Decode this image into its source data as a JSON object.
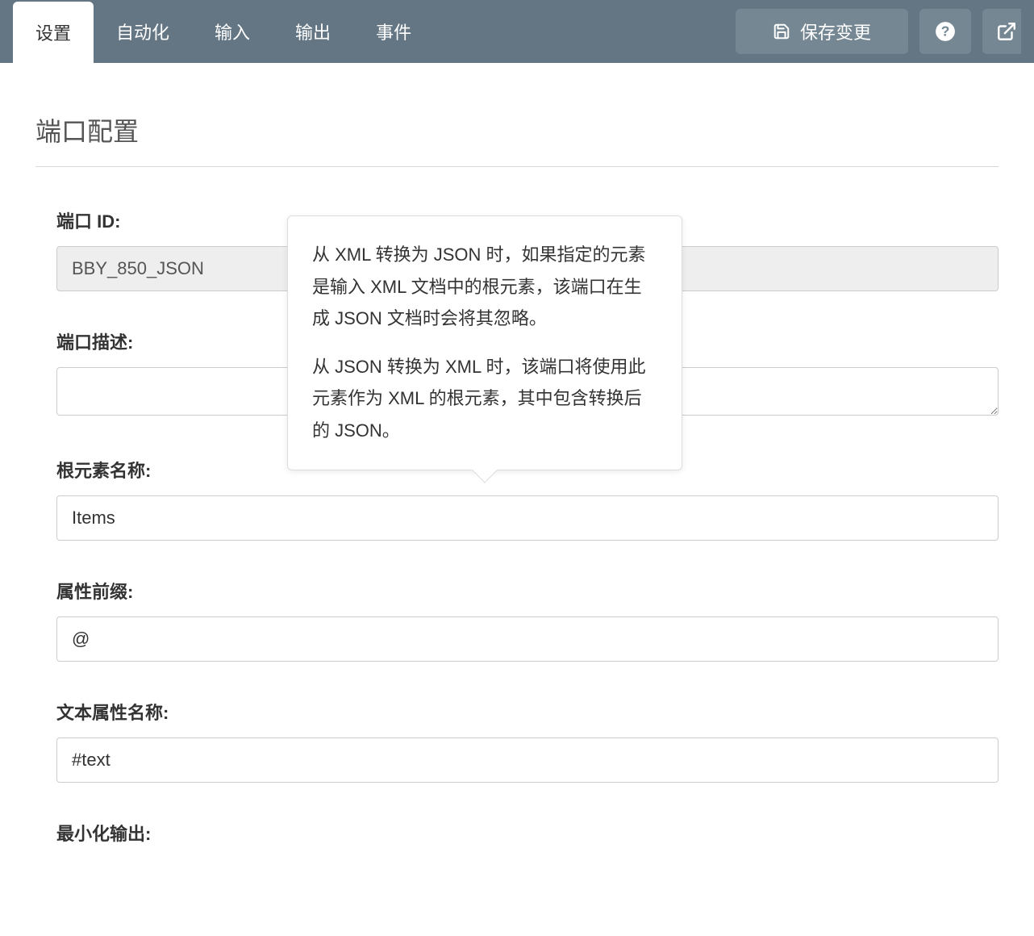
{
  "tabs": {
    "settings": "设置",
    "automation": "自动化",
    "input": "输入",
    "output": "输出",
    "events": "事件"
  },
  "header": {
    "save_label": "保存变更"
  },
  "page": {
    "title": "端口配置"
  },
  "fields": {
    "port_id": {
      "label": "端口 ID:",
      "value": "BBY_850_JSON"
    },
    "port_desc": {
      "label": "端口描述:",
      "value": ""
    },
    "root_element": {
      "label": "根元素名称:",
      "value": "Items"
    },
    "attr_prefix": {
      "label": "属性前缀:",
      "value": "@"
    },
    "text_attr_name": {
      "label": "文本属性名称:",
      "value": "#text"
    },
    "minimize_output": {
      "label": "最小化输出:"
    }
  },
  "tooltip": {
    "p1": "从 XML 转换为 JSON 时，如果指定的元素是输入 XML 文档中的根元素，该端口在生成 JSON 文档时会将其忽略。",
    "p2": "从 JSON 转换为 XML 时，该端口将使用此元素作为 XML 的根元素，其中包含转换后的 JSON。"
  }
}
